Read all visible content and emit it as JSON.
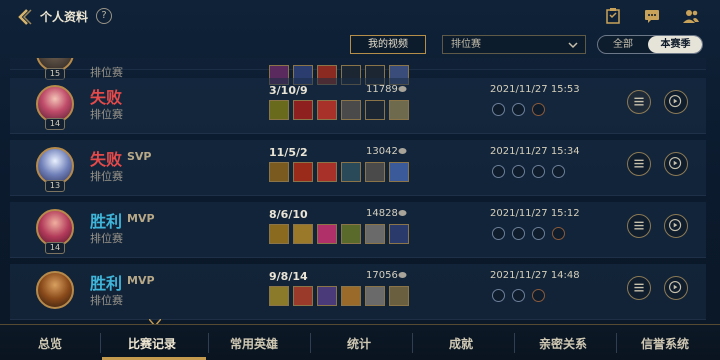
{
  "header": {
    "title": "个人资料",
    "help_symbol": "?"
  },
  "filters": {
    "my_video": "我的视频",
    "mode_select": "排位赛",
    "seg_all": "全部",
    "seg_season": "本赛季"
  },
  "matches": [
    {
      "result": "",
      "badge": "",
      "mode": "排位赛",
      "level": "15",
      "kda": "",
      "gold": "",
      "date": "",
      "status": "partial"
    },
    {
      "result": "失败",
      "badge": "",
      "mode": "排位赛",
      "level": "14",
      "kda": "3/10/9",
      "gold": "11789",
      "date": "2021/11/27 15:53",
      "status": "lose"
    },
    {
      "result": "失败",
      "badge": "SVP",
      "mode": "排位赛",
      "level": "13",
      "kda": "11/5/2",
      "gold": "13042",
      "date": "2021/11/27 15:34",
      "status": "lose"
    },
    {
      "result": "胜利",
      "badge": "MVP",
      "mode": "排位赛",
      "level": "14",
      "kda": "8/6/10",
      "gold": "14828",
      "date": "2021/11/27 15:12",
      "status": "win"
    },
    {
      "result": "胜利",
      "badge": "MVP",
      "mode": "排位赛",
      "level": "",
      "kda": "9/8/14",
      "gold": "17056",
      "date": "2021/11/27 14:48",
      "status": "win"
    }
  ],
  "nav": {
    "tabs": [
      "总览",
      "比赛记录",
      "常用英雄",
      "统计",
      "成就",
      "亲密关系",
      "信誉系统"
    ],
    "active": "比赛记录"
  },
  "colors": {
    "lose": "#e44a4a",
    "win": "#3fb5d9",
    "accent_gold": "#c49a4e"
  }
}
